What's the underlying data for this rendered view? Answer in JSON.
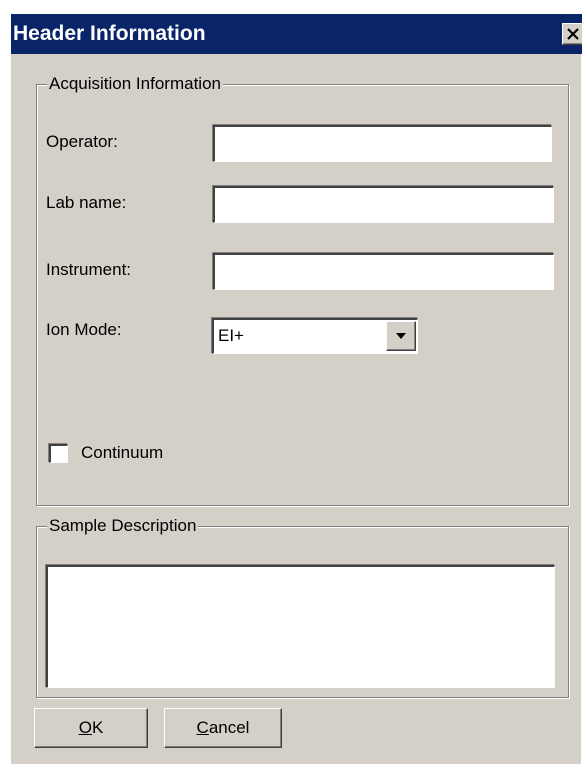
{
  "dialog": {
    "title": "Header Information",
    "close_icon": "close-x-icon"
  },
  "acquisition": {
    "group_label": "Acquisition Information",
    "operator": {
      "label": "Operator:",
      "value": ""
    },
    "lab_name": {
      "label": "Lab name:",
      "value": ""
    },
    "instrument": {
      "label": "Instrument:",
      "value": ""
    },
    "ion_mode": {
      "label": "Ion Mode:",
      "selected": "EI+",
      "arrow_icon": "dropdown-arrow-icon"
    },
    "continuum": {
      "label": "Continuum",
      "checked": false
    }
  },
  "sample": {
    "group_label": "Sample Description",
    "value": ""
  },
  "buttons": {
    "ok": {
      "mnemonic": "O",
      "rest": "K"
    },
    "cancel": {
      "mnemonic": "C",
      "rest": "ancel"
    }
  },
  "colors": {
    "titlebar": "#0a246a",
    "face": "#d4d0c8",
    "field": "#ffffff"
  }
}
